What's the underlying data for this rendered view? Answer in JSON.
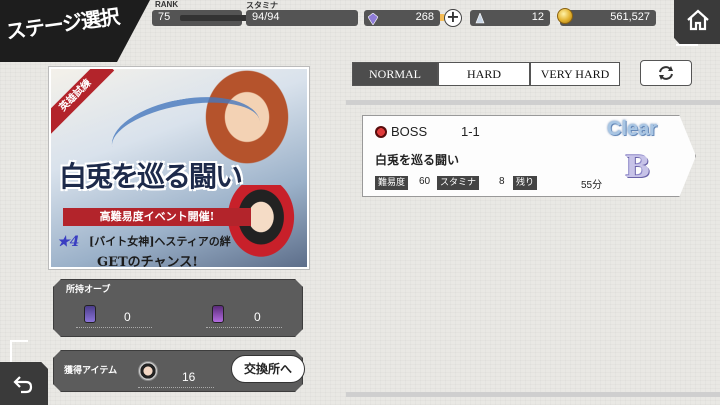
{
  "header": {
    "title": "ステージ選択",
    "rank_label": "RANK",
    "rank_value": "75",
    "stamina_label": "スタミナ",
    "stamina_value": "94/94",
    "stamina_fill": 1.0,
    "crystal_value": "268",
    "plus_symbol": "+",
    "shard_value": "12",
    "coin_value": "561,527",
    "icons": [
      "home-icon",
      "crystal-icon",
      "shard-icon",
      "coin-icon"
    ]
  },
  "banner": {
    "ribbon": "英雄試練",
    "title": "白兎を巡る闘い",
    "subtitle": "高難易度イベント開催!",
    "star": "★",
    "star_rank": "4",
    "note_line1": "[バイト女神]ヘスティアの絆",
    "note_line2": "GETのチャンス!"
  },
  "orbs": {
    "label": "所持オーブ",
    "items": [
      {
        "icon": "orb-icon",
        "count": "0"
      },
      {
        "icon": "orb-icon",
        "count": "0"
      }
    ]
  },
  "items_panel": {
    "label": "獲得アイテム",
    "count": "16",
    "exchange_label": "交換所へ"
  },
  "tabs": {
    "items": [
      "NORMAL",
      "HARD",
      "VERY HARD"
    ],
    "active": "NORMAL",
    "refresh_icon": "refresh-icon"
  },
  "stage": {
    "boss_label": "BOSS",
    "stage_no": "1-1",
    "name": "白兎を巡る闘い",
    "difficulty_label": "難易度",
    "difficulty_value": "60",
    "stamina_label": "スタミナ",
    "stamina_value": "8",
    "remaining_label": "残り",
    "remaining_value": "55分",
    "status": "Clear",
    "rank": "B"
  },
  "colors": {
    "accent_red": "#b3242b",
    "dark_panel": "#5c5c5c",
    "active_tab": "#4d4d4d",
    "clear_blue": "#a9c6e4"
  }
}
